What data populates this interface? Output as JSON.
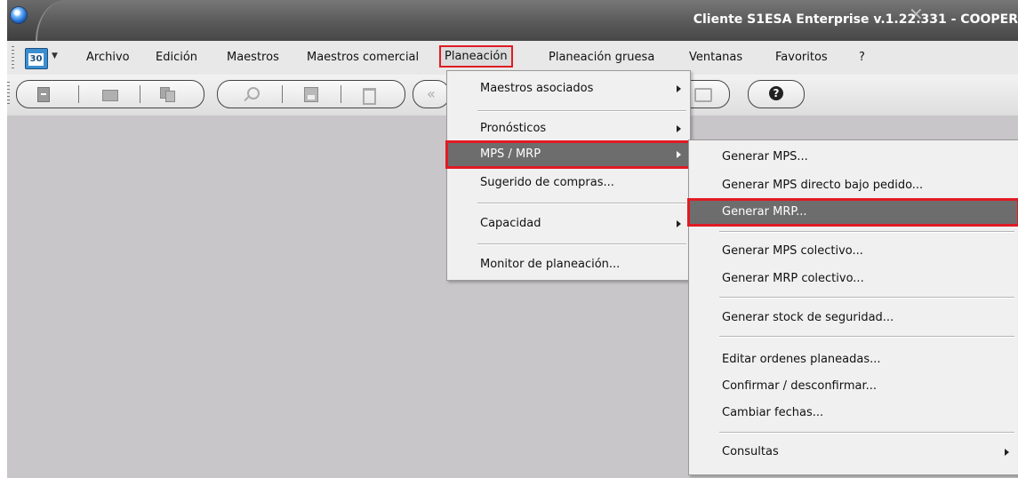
{
  "window": {
    "title": "Cliente S1ESA Enterprise v.1.22.331 - COOPER"
  },
  "menubar": {
    "calendar_day": "30",
    "items": [
      {
        "label": "Archivo"
      },
      {
        "label": "Edición"
      },
      {
        "label": "Maestros"
      },
      {
        "label": "Maestros comercial"
      },
      {
        "label": "Planeación",
        "active": true
      },
      {
        "label": "Planeación gruesa"
      },
      {
        "label": "Ventanas"
      },
      {
        "label": "Favoritos"
      },
      {
        "label": "?"
      }
    ]
  },
  "toolbar": {
    "buttons": [
      "new-document-icon",
      "open-folder-icon",
      "copy-icon",
      "search-icon",
      "save-icon",
      "delete-icon",
      "back-icon",
      "print-icon",
      "help-icon"
    ]
  },
  "planeacion_menu": {
    "items": [
      {
        "label": "Maestros asociados",
        "submenu": true
      },
      {
        "label": "Pronósticos",
        "submenu": true
      },
      {
        "label": "MPS / MRP",
        "submenu": true,
        "highlighted": true
      },
      {
        "label": "Sugerido de compras..."
      },
      {
        "label": "Capacidad",
        "submenu": true
      },
      {
        "label": "Monitor de planeación..."
      }
    ]
  },
  "mps_mrp_submenu": {
    "items": [
      {
        "label": "Generar MPS..."
      },
      {
        "label": "Generar MPS directo bajo pedido..."
      },
      {
        "label": "Generar MRP...",
        "highlighted": true
      },
      {
        "label": "Generar MPS colectivo..."
      },
      {
        "label": "Generar MRP colectivo..."
      },
      {
        "label": "Generar stock de seguridad..."
      },
      {
        "label": "Editar ordenes planeadas..."
      },
      {
        "label": "Confirmar / desconfirmar..."
      },
      {
        "label": "Cambiar fechas..."
      },
      {
        "label": "Consultas",
        "submenu": true
      }
    ]
  },
  "colors": {
    "highlight_outline": "#e01b24",
    "highlight_background": "#6d6d6d",
    "workspace_background": "#c8c6c8"
  }
}
